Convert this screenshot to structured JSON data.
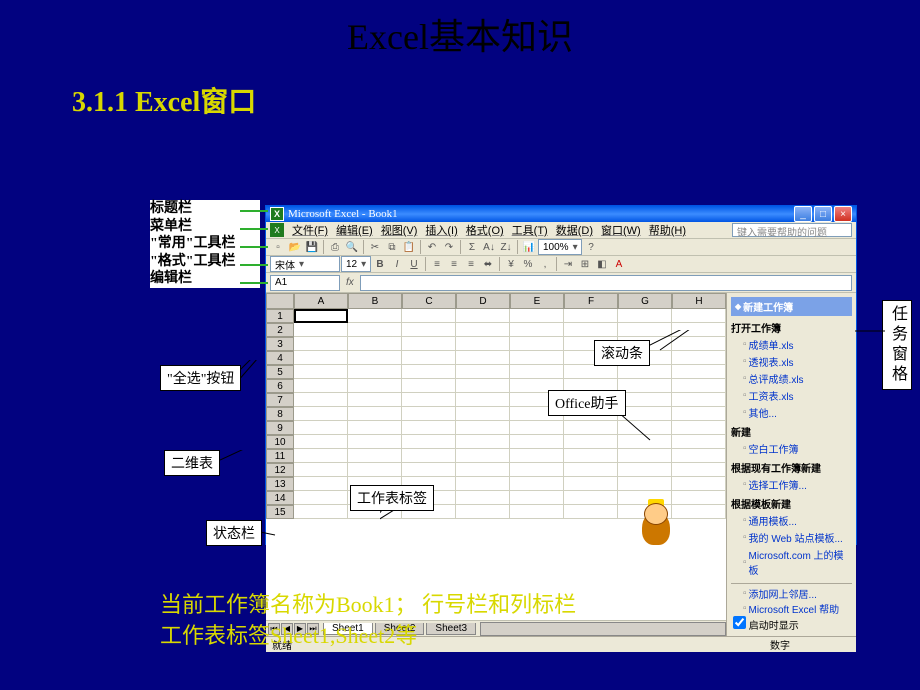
{
  "slide": {
    "title": "Excel基本知识",
    "section_heading": "3.1.1  Excel窗口"
  },
  "excel": {
    "titlebar": "Microsoft Excel - Book1",
    "menus": [
      "文件(F)",
      "编辑(E)",
      "视图(V)",
      "插入(I)",
      "格式(O)",
      "工具(T)",
      "数据(D)",
      "窗口(W)",
      "帮助(H)"
    ],
    "help_placeholder": "键入需要帮助的问题",
    "font_name": "宋体",
    "font_size": "12",
    "zoom": "100%",
    "namebox": "A1",
    "fx": "fx",
    "columns": [
      "A",
      "B",
      "C",
      "D",
      "E",
      "F",
      "G",
      "H"
    ],
    "rows": [
      "1",
      "2",
      "3",
      "4",
      "5",
      "6",
      "7",
      "8",
      "9",
      "10",
      "11",
      "12",
      "13",
      "14",
      "15"
    ],
    "sheets": [
      "Sheet1",
      "Sheet2",
      "Sheet3"
    ],
    "status_left": "就绪",
    "status_right": "数字"
  },
  "taskpane": {
    "title": "新建工作簿",
    "open_section": "打开工作簿",
    "files": [
      "成绩单.xls",
      "透视表.xls",
      "总评成绩.xls",
      "工资表.xls"
    ],
    "more": "其他...",
    "new_section": "新建",
    "blank": "空白工作簿",
    "from_existing_section": "根据现有工作簿新建",
    "choose": "选择工作簿...",
    "from_template_section": "根据模板新建",
    "templates": [
      "通用模板...",
      "我的 Web 站点模板...",
      "Microsoft.com 上的模板"
    ],
    "add_place": "添加网上邻居...",
    "excel_help": "Microsoft Excel 帮助",
    "show_startup": "启动时显示"
  },
  "labels": {
    "titlebar": "标题栏",
    "menubar": "菜单栏",
    "std_toolbar": "\"常用\"工具栏",
    "fmt_toolbar": "\"格式\"工具栏",
    "formulabar": "编辑栏",
    "select_all": "\"全选\"按钮",
    "table2d": "二维表",
    "sheet_tabs": "工作表标签",
    "statusbar": "状态栏",
    "scrollbar": "滚动条",
    "assistant": "Office助手",
    "taskpane": "任务窗格"
  },
  "footer": {
    "line1": "当前工作簿名称为Book1；   行号栏和列标栏",
    "line2": "工作表标签Sheet1,Sheet2等"
  }
}
